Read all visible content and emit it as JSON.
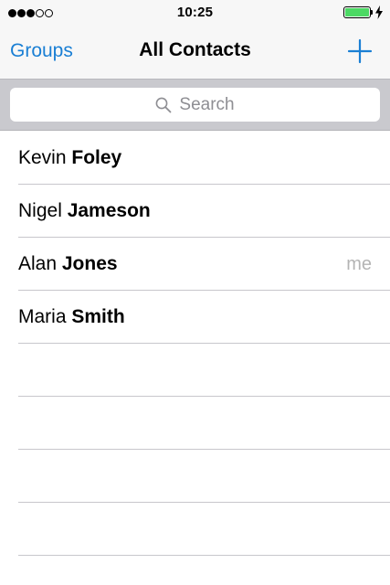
{
  "status_bar": {
    "signal_dots": [
      true,
      true,
      true,
      false,
      false
    ],
    "time": "10:25",
    "battery_level": 1.0,
    "battery_color": "#4cd964",
    "charging": true
  },
  "nav_bar": {
    "left_label": "Groups",
    "title": "All Contacts",
    "right_icon": "plus-icon",
    "accent_color": "#1a7fd4"
  },
  "search": {
    "placeholder": "Search",
    "icon": "search-icon"
  },
  "contacts": [
    {
      "first": "Kevin",
      "last": "Foley",
      "tag": ""
    },
    {
      "first": "Nigel",
      "last": "Jameson",
      "tag": ""
    },
    {
      "first": "Alan",
      "last": "Jones",
      "tag": "me"
    },
    {
      "first": "Maria",
      "last": "Smith",
      "tag": ""
    }
  ],
  "empty_rows": 4
}
